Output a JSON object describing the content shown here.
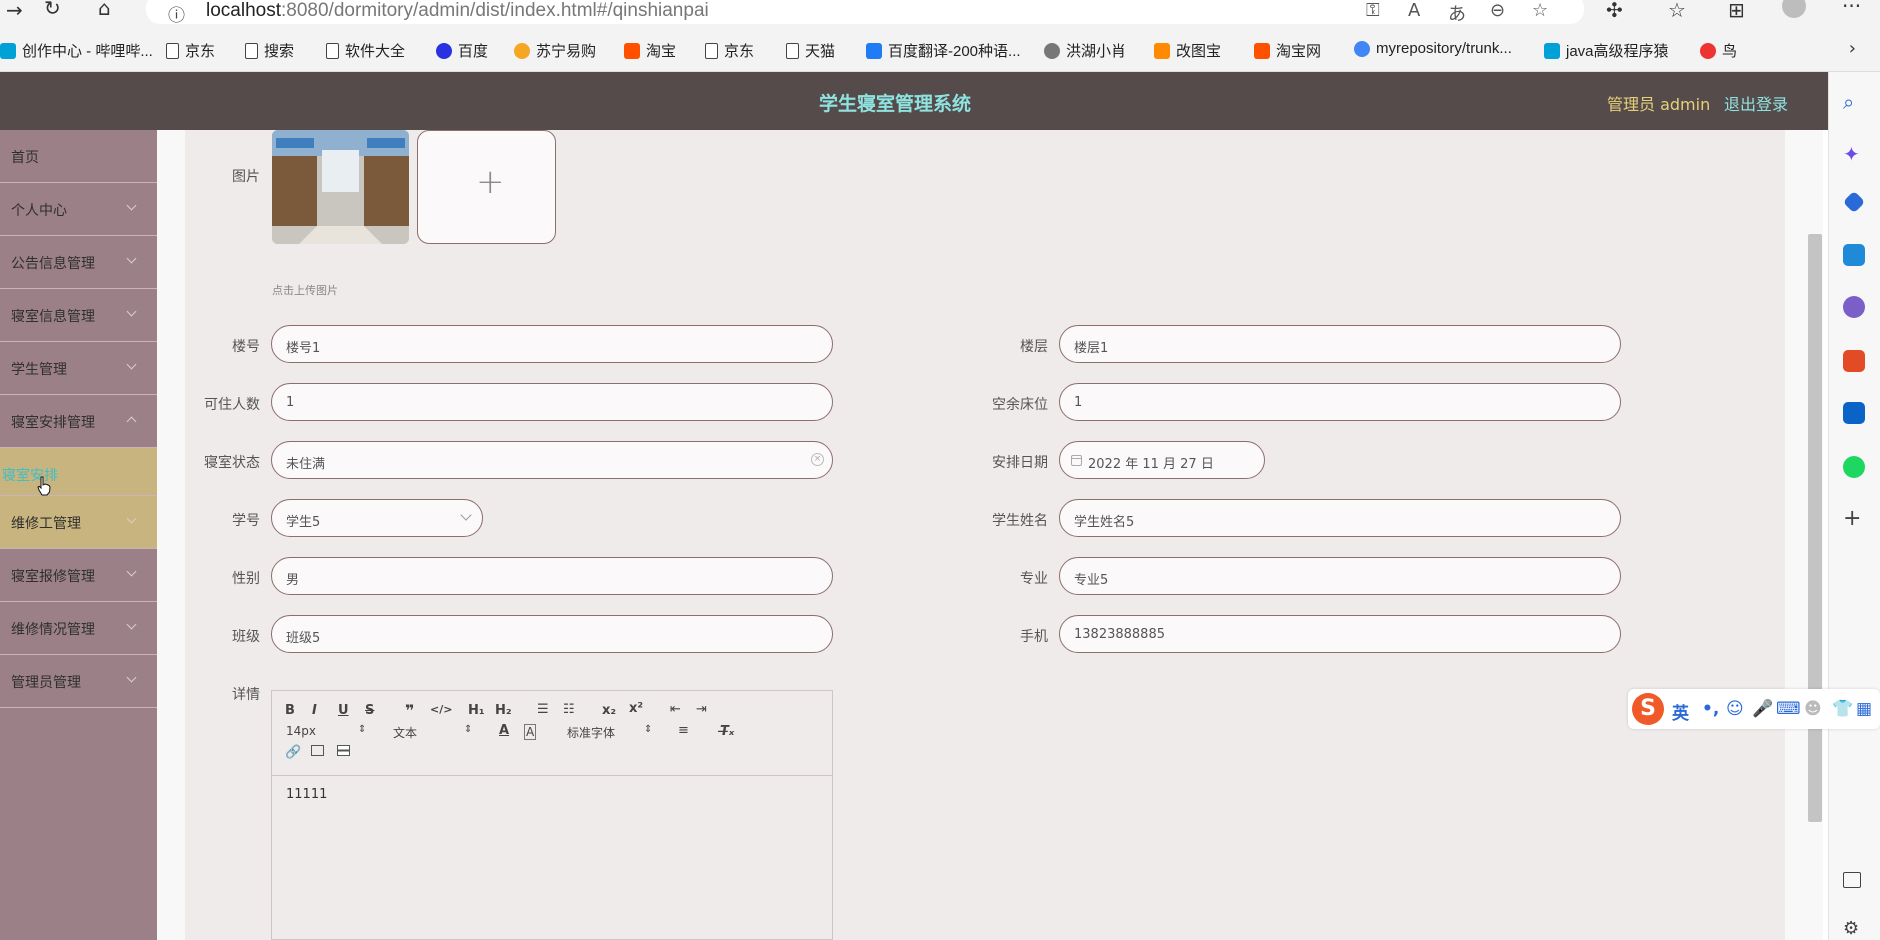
{
  "browser": {
    "url_host": "localhost",
    "url_path": ":8080/dormitory/admin/dist/index.html#/qinshianpai"
  },
  "bookmarks": [
    {
      "label": "创作中心 - 哔哩哔...",
      "icon": "bilibili-icon",
      "color": "#00a1d6"
    },
    {
      "label": "京东",
      "icon": "page-icon",
      "color": "#444444"
    },
    {
      "label": "搜索",
      "icon": "page-icon",
      "color": "#444444"
    },
    {
      "label": "软件大全",
      "icon": "page-icon",
      "color": "#444444"
    },
    {
      "label": "百度",
      "icon": "baidu-icon",
      "color": "#2932e1"
    },
    {
      "label": "苏宁易购",
      "icon": "suning-icon",
      "color": "#f5a623"
    },
    {
      "label": "淘宝",
      "icon": "taobao-icon",
      "color": "#ff5000"
    },
    {
      "label": "京东",
      "icon": "page-icon",
      "color": "#444444"
    },
    {
      "label": "天猫",
      "icon": "page-icon",
      "color": "#444444"
    },
    {
      "label": "百度翻译-200种语...",
      "icon": "translate-icon",
      "color": "#1f7cf5"
    },
    {
      "label": "洪湖小肖",
      "icon": "bird-icon",
      "color": "#555555"
    },
    {
      "label": "改图宝",
      "icon": "gaitubao-icon",
      "color": "#ff8a00"
    },
    {
      "label": "淘宝网",
      "icon": "taobao-icon",
      "color": "#ff5000"
    },
    {
      "label": "myrepository/trunk...",
      "icon": "chrome-icon",
      "color": "#4285f4"
    },
    {
      "label": "java高级程序猿",
      "icon": "bilibili-icon",
      "color": "#00a1d6"
    },
    {
      "label": "鸟",
      "icon": "bird-icon",
      "color": "#e33"
    }
  ],
  "header": {
    "title": "学生寝室管理系统",
    "admin_label": "管理员 admin",
    "logout_label": "退出登录"
  },
  "sidebar": {
    "items": [
      {
        "label": "首页",
        "has_arrow": false
      },
      {
        "label": "个人中心",
        "has_arrow": true
      },
      {
        "label": "公告信息管理",
        "has_arrow": true
      },
      {
        "label": "寝室信息管理",
        "has_arrow": true
      },
      {
        "label": "学生管理",
        "has_arrow": true
      },
      {
        "label": "寝室安排管理",
        "has_arrow": true
      },
      {
        "label": "寝室安排",
        "has_arrow": false,
        "active_sub": true
      },
      {
        "label": "维修工管理",
        "has_arrow": true
      },
      {
        "label": "寝室报修管理",
        "has_arrow": true
      },
      {
        "label": "维修情况管理",
        "has_arrow": true
      },
      {
        "label": "管理员管理",
        "has_arrow": true
      }
    ]
  },
  "form": {
    "image_label": "图片",
    "upload_tip": "点击上传图片",
    "building_label": "楼号",
    "building_value": "楼号1",
    "floor_label": "楼层",
    "floor_value": "楼层1",
    "capacity_label": "可住人数",
    "capacity_value": "1",
    "free_beds_label": "空余床位",
    "free_beds_value": "1",
    "status_label": "寝室状态",
    "status_value": "未住满",
    "date_label": "安排日期",
    "date_value": "2022 年 11 月 27 日",
    "student_id_label": "学号",
    "student_id_value": "学生5",
    "student_name_label": "学生姓名",
    "student_name_value": "学生姓名5",
    "gender_label": "性别",
    "gender_value": "男",
    "major_label": "专业",
    "major_value": "专业5",
    "class_label": "班级",
    "class_value": "班级5",
    "phone_label": "手机",
    "phone_value": "13823888885",
    "detail_label": "详情"
  },
  "editor": {
    "font_size": "14px",
    "text_type": "文本",
    "font_family": "标准字体",
    "content": "11111"
  },
  "colors": {
    "header_bg": "#554b4b",
    "title_color": "#8ee3e0",
    "sidebar_bg": "#9b8087",
    "active_bg": "#c8b47e",
    "content_bg": "#efebea"
  }
}
